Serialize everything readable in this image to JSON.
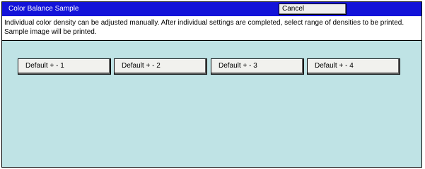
{
  "dialog": {
    "title": "Color Balance Sample",
    "cancel_label": "Cancel",
    "description": "Individual color density can be adjusted manually. After individual settings are completed, select range of densities to be printed. Sample image will be printed."
  },
  "options": [
    {
      "label": "Default + - 1"
    },
    {
      "label": "Default + - 2"
    },
    {
      "label": "Default + - 3"
    },
    {
      "label": "Default + - 4"
    }
  ],
  "colors": {
    "titlebar": "#1313d9",
    "panel": "#bfe3e5",
    "button": "#f1f1ee"
  }
}
